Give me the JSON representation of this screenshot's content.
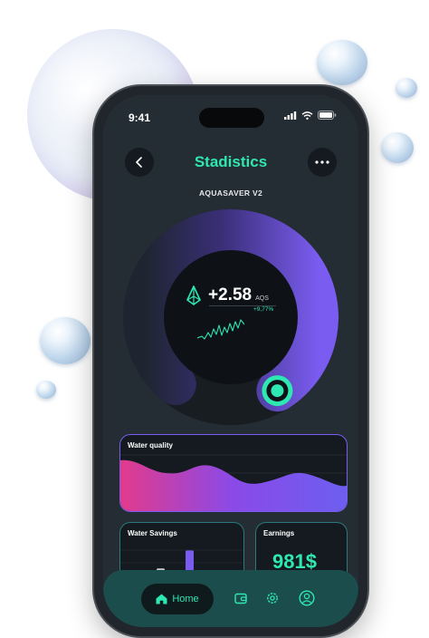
{
  "status": {
    "time": "9:41"
  },
  "header": {
    "title": "Stadistics",
    "subtitle": "AQUASAVER V2"
  },
  "dial": {
    "value": "+2.58",
    "unit": "AQS",
    "delta": "+9,77%",
    "progress": 0.8
  },
  "cards": {
    "water_quality": {
      "label": "Water quality"
    },
    "water_savings": {
      "label": "Water Savings",
      "bars": [
        0.45,
        0.2,
        0.9,
        0.35,
        0.15
      ]
    },
    "earnings": {
      "label": "Earnings",
      "value": "981$"
    }
  },
  "nav": {
    "home_label": "Home"
  },
  "colors": {
    "accent": "#2ee8b1",
    "purple": "#7a5cf0",
    "pink": "#e23a8c",
    "nav_bg": "#1c4d4d"
  }
}
